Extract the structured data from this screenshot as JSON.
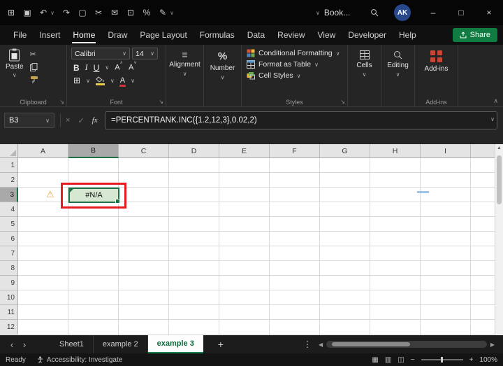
{
  "titlebar": {
    "qat": [
      {
        "name": "view-switcher",
        "glyph": "⊞"
      },
      {
        "name": "save",
        "glyph": "▣"
      },
      {
        "name": "undo",
        "glyph": "↶"
      },
      {
        "name": "redo",
        "glyph": "↷"
      },
      {
        "name": "copy",
        "glyph": "▢"
      },
      {
        "name": "cut",
        "glyph": "✂"
      },
      {
        "name": "mail",
        "glyph": "✉"
      },
      {
        "name": "print",
        "glyph": "⊡"
      },
      {
        "name": "percent",
        "glyph": "%"
      },
      {
        "name": "pen",
        "glyph": "✎"
      },
      {
        "name": "more-commands",
        "glyph": "∨"
      }
    ],
    "workbook_name": "Book...",
    "avatar_initials": "AK",
    "window": {
      "minimize": "–",
      "maximize": "□",
      "close": "×"
    }
  },
  "menu": {
    "items": [
      "File",
      "Insert",
      "Home",
      "Draw",
      "Page Layout",
      "Formulas",
      "Data",
      "Review",
      "View",
      "Developer",
      "Help"
    ],
    "active_item": "Home",
    "share_label": "Share"
  },
  "ribbon": {
    "clipboard": {
      "paste_label": "Paste",
      "group_label": "Clipboard"
    },
    "font": {
      "family": "Calibri",
      "size": "14",
      "bold": "B",
      "italic": "I",
      "underline": "U",
      "grow": "A",
      "shrink": "A",
      "color_letter": "A",
      "borders": "⊞",
      "group_label": "Font"
    },
    "alignment": {
      "label": "Alignment"
    },
    "number": {
      "label": "Number",
      "percent": "%"
    },
    "styles": {
      "rows": [
        {
          "label": "Conditional Formatting"
        },
        {
          "label": "Format as Table"
        },
        {
          "label": "Cell Styles"
        }
      ],
      "group_label": "Styles"
    },
    "cells": {
      "label": "Cells"
    },
    "editing": {
      "label": "Editing"
    },
    "addins": {
      "label": "Add-ins",
      "group_label": "Add-ins"
    }
  },
  "formula_bar": {
    "name_box": "B3",
    "cancel": "×",
    "enter": "✓",
    "fx": "fx",
    "formula": "=PERCENTRANK.INC({1.2,12,3},0.02,2)"
  },
  "grid": {
    "columns": [
      "A",
      "B",
      "C",
      "D",
      "E",
      "F",
      "G",
      "H",
      "I"
    ],
    "rows": [
      "1",
      "2",
      "3",
      "4",
      "5",
      "6",
      "7",
      "8",
      "9",
      "10",
      "11",
      "12"
    ],
    "selected_column": "B",
    "selected_row": "3",
    "active_cell": {
      "ref": "B3",
      "display": "#N/A"
    }
  },
  "sheet_tabs": {
    "tabs": [
      {
        "label": "Sheet1",
        "active": false
      },
      {
        "label": "example 2",
        "active": false
      },
      {
        "label": "example 3",
        "active": true
      }
    ],
    "add": "+",
    "menu": "⋮"
  },
  "status_bar": {
    "mode": "Ready",
    "accessibility": "Accessibility: Investigate",
    "views": [
      "▦",
      "▥",
      "◫"
    ],
    "zoom_out": "−",
    "zoom_in": "+",
    "zoom_level": "100%"
  },
  "glyphs": {
    "chevron_down": "∨",
    "chevron_up": "∧",
    "launcher": "↘",
    "warning": "⚠",
    "triangle_up": "▲",
    "align_lines": "≡",
    "nav_left": "‹",
    "nav_right": "›",
    "scroll_left": "◀",
    "scroll_right": "▶"
  },
  "colors": {
    "accent_green": "#107c41",
    "selection_green": "#1e7145",
    "annotation_red": "#e51b24",
    "cell_fill_green": "#d6e8d2",
    "warning_orange": "#e8a33d",
    "addins_red": "#c74634"
  }
}
